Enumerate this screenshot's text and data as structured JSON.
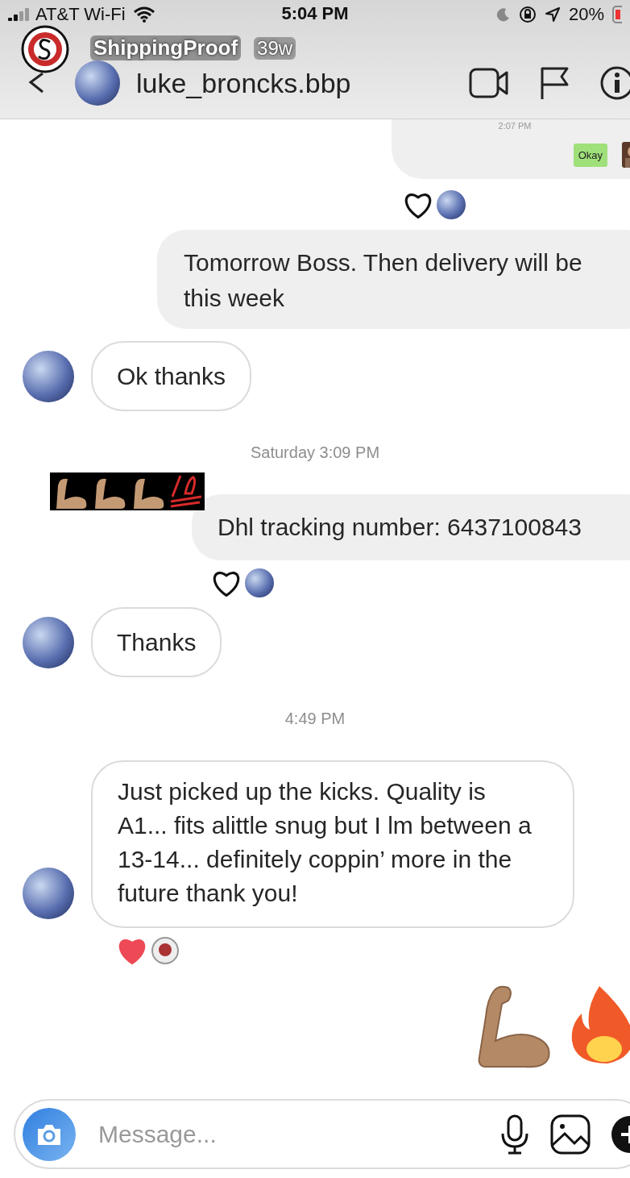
{
  "status_bar": {
    "carrier": "AT&T Wi-Fi",
    "time": "5:04 PM",
    "battery": "20%"
  },
  "story": {
    "account": "ShippingProof",
    "age": "39w"
  },
  "header": {
    "username": "luke_broncks.bbp"
  },
  "messages": [
    {
      "kind": "image_reply",
      "time": "2:07 PM",
      "bubble": "Okay"
    },
    {
      "kind": "reactions",
      "liked": false
    },
    {
      "kind": "sent_text",
      "text": "Tomorrow Boss. Then delivery will be this week",
      "sticker": false
    },
    {
      "kind": "received_text",
      "text": "Ok thanks"
    },
    {
      "kind": "timestamp",
      "text": "Saturday 3:09 PM"
    },
    {
      "kind": "sent_text",
      "text": "Dhl tracking number: 6437100843",
      "sticker": true
    },
    {
      "kind": "reactions",
      "liked": false
    },
    {
      "kind": "received_text",
      "text": "Thanks"
    },
    {
      "kind": "timestamp",
      "text": "4:49 PM"
    },
    {
      "kind": "received_text",
      "text": "Just picked up the kicks. Quality is A1... fits alittle snug but I lm between a 13-14... definitely coppin’ more in the future thank you!"
    },
    {
      "kind": "reactions",
      "liked": true
    },
    {
      "kind": "emojis"
    }
  ],
  "composer": {
    "placeholder": "Message..."
  }
}
